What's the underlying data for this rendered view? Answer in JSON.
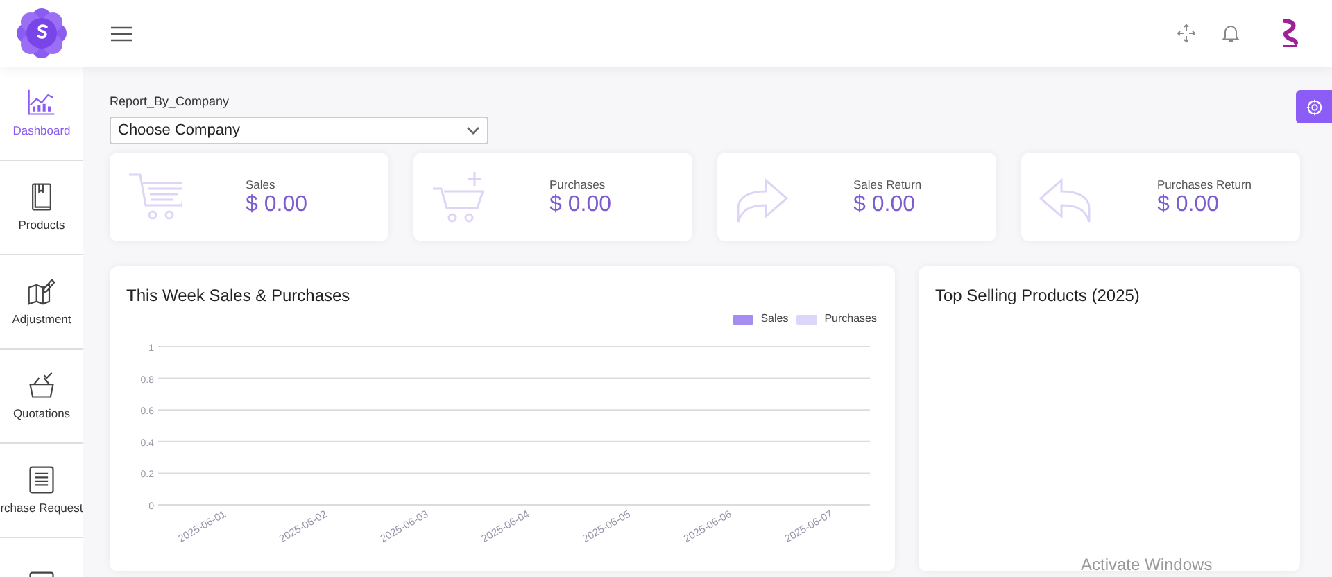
{
  "sidebar": {
    "items": [
      {
        "label": "Dashboard",
        "selected": true
      },
      {
        "label": "Products",
        "selected": false
      },
      {
        "label": "Adjustment",
        "selected": false
      },
      {
        "label": "Quotations",
        "selected": false
      },
      {
        "label": "rchase Request",
        "selected": false
      },
      {
        "selected": false
      }
    ]
  },
  "filter": {
    "label": "Report_By_Company",
    "value": "Choose Company"
  },
  "stats": [
    {
      "kind": "cart",
      "label": "Sales",
      "value": "$ 0.00"
    },
    {
      "kind": "cart-plus",
      "label": "Purchases",
      "value": "$ 0.00"
    },
    {
      "kind": "forward",
      "label": "Sales Return",
      "value": "$ 0.00"
    },
    {
      "kind": "back",
      "label": "Purchases Return",
      "value": "$ 0.00"
    }
  ],
  "week_chart": {
    "title": "This Week Sales & Purchases",
    "chart_data": {
      "type": "bar",
      "categories": [
        "2025-06-01",
        "2025-06-02",
        "2025-06-03",
        "2025-06-04",
        "2025-06-05",
        "2025-06-06",
        "2025-06-07"
      ],
      "series": [
        {
          "name": "Sales",
          "color": "#a48cf0",
          "values": [
            0,
            0,
            0,
            0,
            0,
            0,
            0
          ]
        },
        {
          "name": "Purchases",
          "color": "#ddd6fb",
          "values": [
            0,
            0,
            0,
            0,
            0,
            0,
            0
          ]
        }
      ],
      "ylim": [
        0,
        1
      ],
      "grid": true,
      "yticks": [
        0,
        {
          "value": 0.2,
          "label": "0.2"
        },
        {
          "value": 0.4,
          "label": "0.4"
        },
        {
          "value": 0.6,
          "label": "0.6"
        },
        {
          "value": 0.8,
          "label": "0.8"
        },
        1
      ]
    }
  },
  "top_selling": {
    "title": "Top Selling Products (2025)"
  },
  "os_notice": "Activate Windows"
}
